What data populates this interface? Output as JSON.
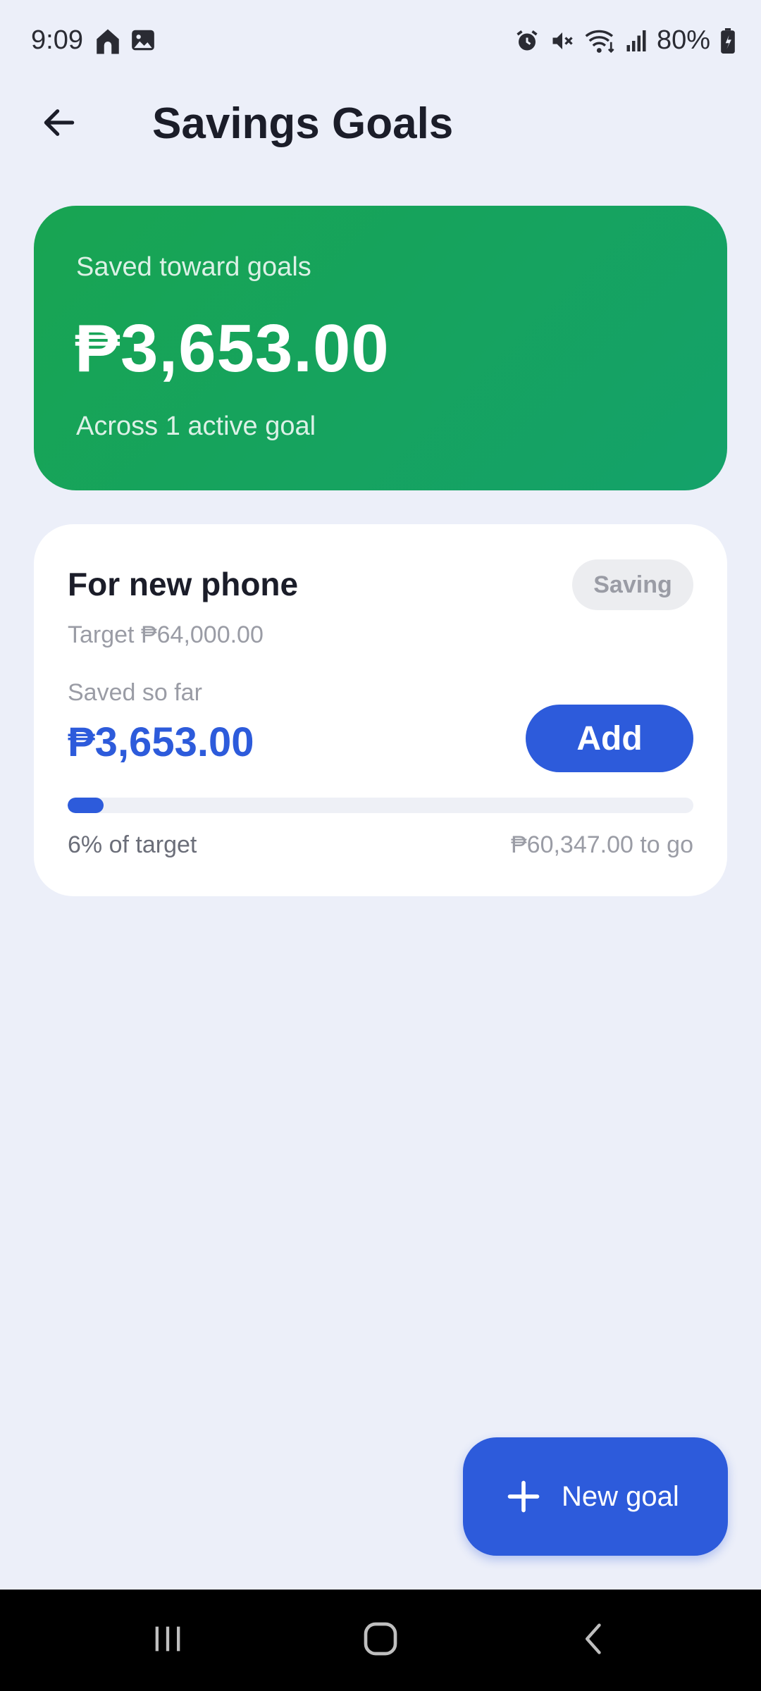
{
  "status_bar": {
    "time": "9:09",
    "battery": "80%",
    "icons": [
      "home-icon",
      "image-icon",
      "alarm-icon",
      "mute-icon",
      "wifi-icon",
      "signal-icon",
      "battery-icon"
    ]
  },
  "header": {
    "title": "Savings Goals",
    "back_icon": "arrow-left-icon"
  },
  "summary": {
    "label": "Saved toward goals",
    "amount": "₱3,653.00",
    "subtitle": "Across 1 active goal",
    "colors": {
      "start": "#18A452",
      "end": "#14A26A"
    }
  },
  "goals": [
    {
      "name": "For new phone",
      "status": "Saving",
      "target": "Target ₱64,000.00",
      "saved_label": "Saved so far",
      "saved_amount": "₱3,653.00",
      "add_label": "Add",
      "progress_fraction": 0.057,
      "percent_text": "6% of target",
      "remaining_text": "₱60,347.00 to go"
    }
  ],
  "fab": {
    "label": "New goal",
    "icon": "plus-icon"
  },
  "nav_bar": {
    "icons": [
      "recent-apps-icon",
      "home-nav-icon",
      "back-nav-icon"
    ]
  },
  "colors": {
    "background": "#ECEFF9",
    "accent": "#2D5BDB",
    "card": "#FFFFFF",
    "badge_bg": "#ECEDF0"
  }
}
